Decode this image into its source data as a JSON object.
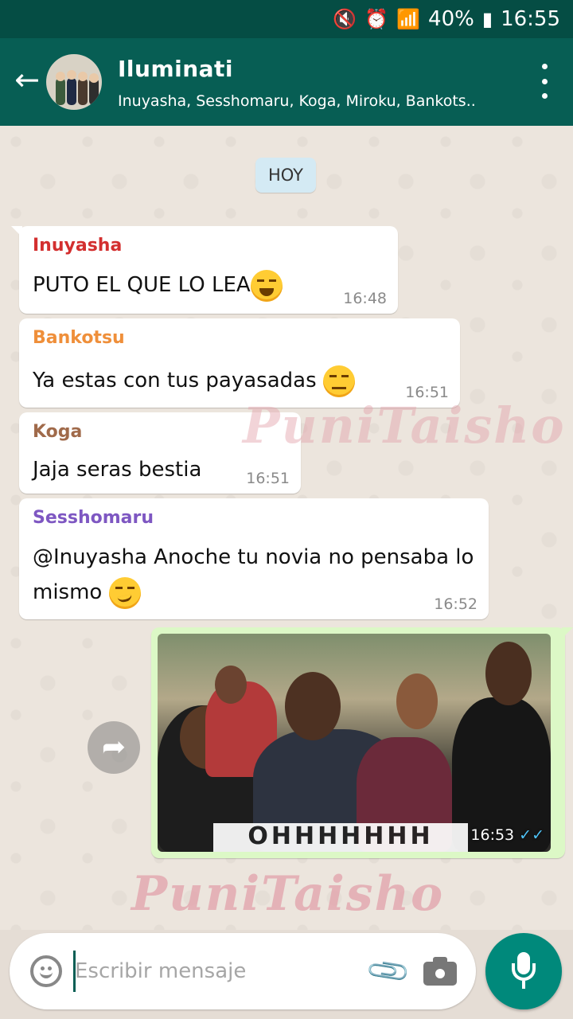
{
  "status_bar": {
    "battery": "40%",
    "time": "16:55",
    "icons": [
      "mute-icon",
      "alarm-icon",
      "wifi-icon",
      "signal-icon",
      "battery-icon"
    ]
  },
  "header": {
    "title": "Iluminati",
    "subtitle": "Inuyasha, Sesshomaru, Koga, Miroku, Bankots..",
    "colors": {
      "bar": "#075e54",
      "status": "#054d44"
    }
  },
  "date_chip": "HOY",
  "messages": [
    {
      "sender": "Inuyasha",
      "text": "PUTO EL QUE LO LEA",
      "time": "16:48",
      "sender_color": "#d32f2f",
      "emoji": "laughing-face"
    },
    {
      "sender": "Bankotsu",
      "text": "Ya estas con tus payasadas ",
      "time": "16:51",
      "sender_color": "#ef8f3a",
      "emoji": "unamused-face"
    },
    {
      "sender": "Koga",
      "text": "Jaja seras bestia",
      "time": "16:51",
      "sender_color": "#a06a4a"
    },
    {
      "sender": "Sesshomaru",
      "text_line1": "@Inuyasha Anoche tu novia no pensaba lo",
      "text_line2": "mismo ",
      "time": "16:52",
      "sender_color": "#7e57c2",
      "emoji": "smirking-face"
    }
  ],
  "image_message": {
    "caption_text": "OHHHHHHH",
    "time": "16:53",
    "status": "read-ticks-icon"
  },
  "watermark": "PuniTaisho",
  "composer": {
    "placeholder": "Escribir mensaje"
  }
}
